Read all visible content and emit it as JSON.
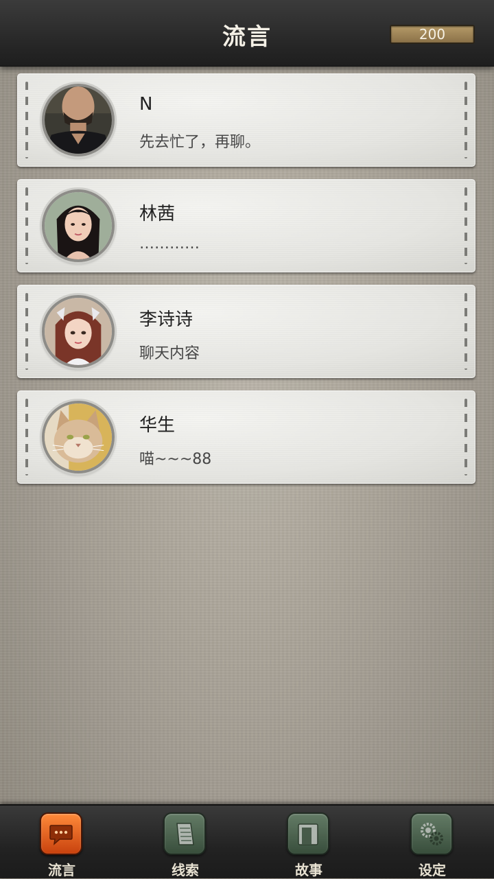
{
  "header": {
    "title": "流言",
    "coins": "200"
  },
  "messages": [
    {
      "name": "N",
      "preview": "先去忙了，再聊。",
      "avatar": "man-portrait-icon"
    },
    {
      "name": "林茜",
      "preview": "…………",
      "avatar": "woman-portrait-icon"
    },
    {
      "name": "李诗诗",
      "preview": "聊天内容",
      "avatar": "girl-portrait-icon"
    },
    {
      "name": "华生",
      "preview": "喵~~~88",
      "avatar": "cat-portrait-icon"
    }
  ],
  "tabs": [
    {
      "label": "流言",
      "icon": "chat-bubble-icon",
      "active": true
    },
    {
      "label": "线索",
      "icon": "notes-icon",
      "active": false
    },
    {
      "label": "故事",
      "icon": "book-icon",
      "active": false
    },
    {
      "label": "设定",
      "icon": "gears-icon",
      "active": false
    }
  ],
  "colors": {
    "active_tab": "#e25a18",
    "inactive_tab": "#587a5c",
    "header_bg": "#2a2a2a",
    "coin_bg": "#a3885a"
  }
}
